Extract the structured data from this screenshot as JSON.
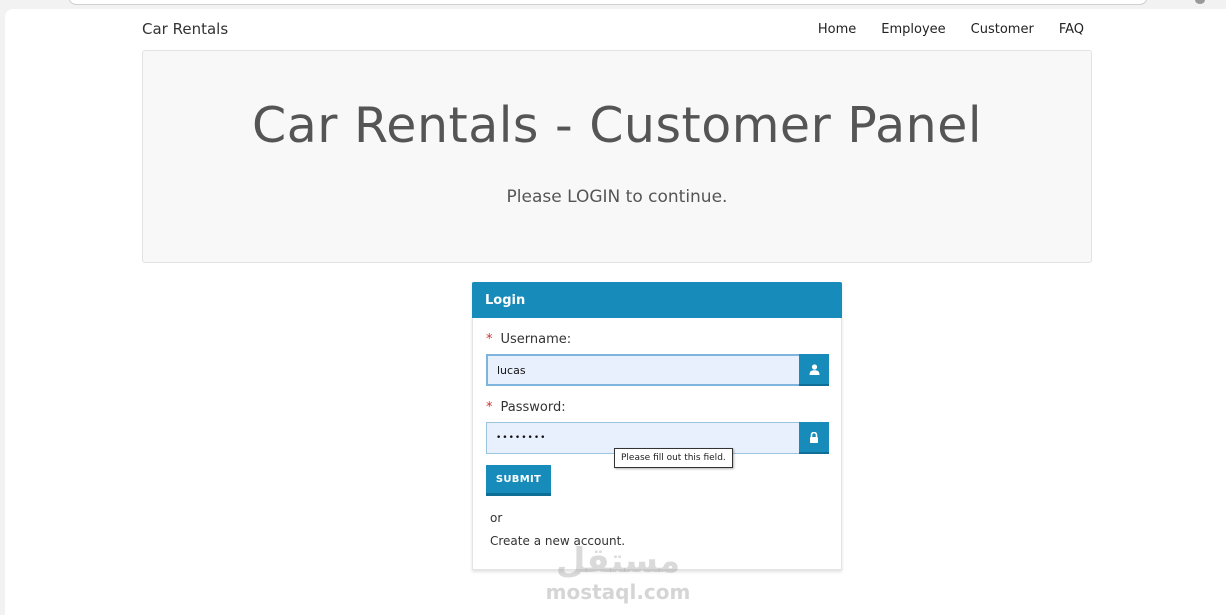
{
  "navbar": {
    "brand": "Car Rentals",
    "links": [
      "Home",
      "Employee",
      "Customer",
      "FAQ"
    ]
  },
  "jumbotron": {
    "title": "Car Rentals - Customer Panel",
    "subtitle": "Please LOGIN to continue."
  },
  "login_panel": {
    "heading": "Login",
    "required_marker": "*",
    "username_label": "Username:",
    "username_value": "lucas",
    "password_label": "Password:",
    "password_value": "••••••••",
    "validation_tooltip": "Please fill out this field.",
    "submit_label": "SUBMIT",
    "or_text": "or",
    "create_account_text": "Create a new account."
  },
  "icons": {
    "username_addon": "user-icon",
    "password_addon": "lock-icon"
  },
  "colors": {
    "accent": "#178cba",
    "input_background": "#e8f0fe",
    "required": "#d32f2f",
    "jumbotron_background": "#f8f8f8"
  },
  "watermark": {
    "arabic": "مستقل",
    "latin": "mostaql.com"
  }
}
